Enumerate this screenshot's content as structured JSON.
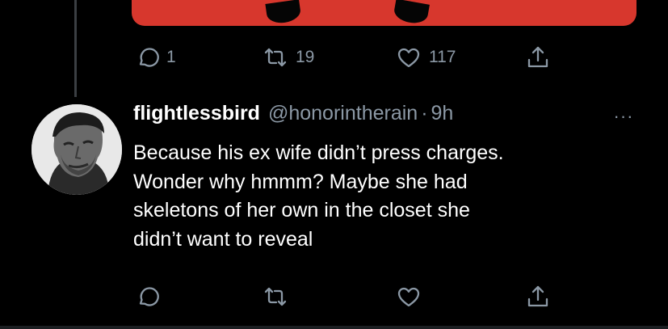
{
  "previous_tweet": {
    "actions": {
      "reply_count": "1",
      "retweet_count": "19",
      "like_count": "117"
    }
  },
  "tweet": {
    "display_name": "flightlessbird",
    "handle": "@honorintherain",
    "separator": "·",
    "time": "9h",
    "more": "···",
    "body_lines": [
      "Because his ex wife didn’t press charges.",
      "Wonder why hmmm? Maybe she had",
      "skeletons of her own in the closet she",
      "didn’t want to reveal"
    ]
  },
  "colors": {
    "background": "#000000",
    "text": "#ffffff",
    "secondary_text": "#8b98a5",
    "media_red": "#d7372d",
    "thread_line": "#3b3f43"
  },
  "icons": [
    "reply-icon",
    "retweet-icon",
    "like-icon",
    "share-icon",
    "more-icon"
  ]
}
